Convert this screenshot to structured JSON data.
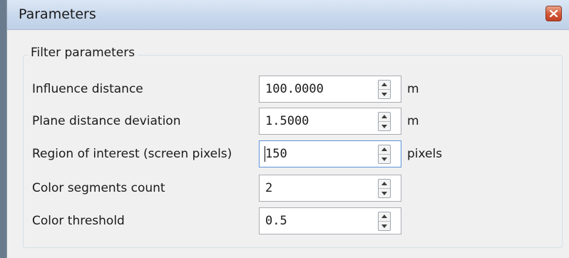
{
  "window": {
    "title": "Parameters",
    "close_icon": "close-icon"
  },
  "group": {
    "title": "Filter parameters"
  },
  "rows": [
    {
      "label": "Influence distance",
      "value": "100.0000",
      "unit": "m"
    },
    {
      "label": "Plane distance deviation",
      "value": "1.5000",
      "unit": "m"
    },
    {
      "label": "Region of interest (screen pixels)",
      "value": "150",
      "unit": "pixels"
    },
    {
      "label": "Color segments count",
      "value": "2",
      "unit": ""
    },
    {
      "label": "Color threshold",
      "value": "0.5",
      "unit": ""
    }
  ],
  "colors": {
    "titlebar": "#c8d8ec",
    "close_button": "#d55a3a",
    "focus_border": "#5c93d8"
  }
}
